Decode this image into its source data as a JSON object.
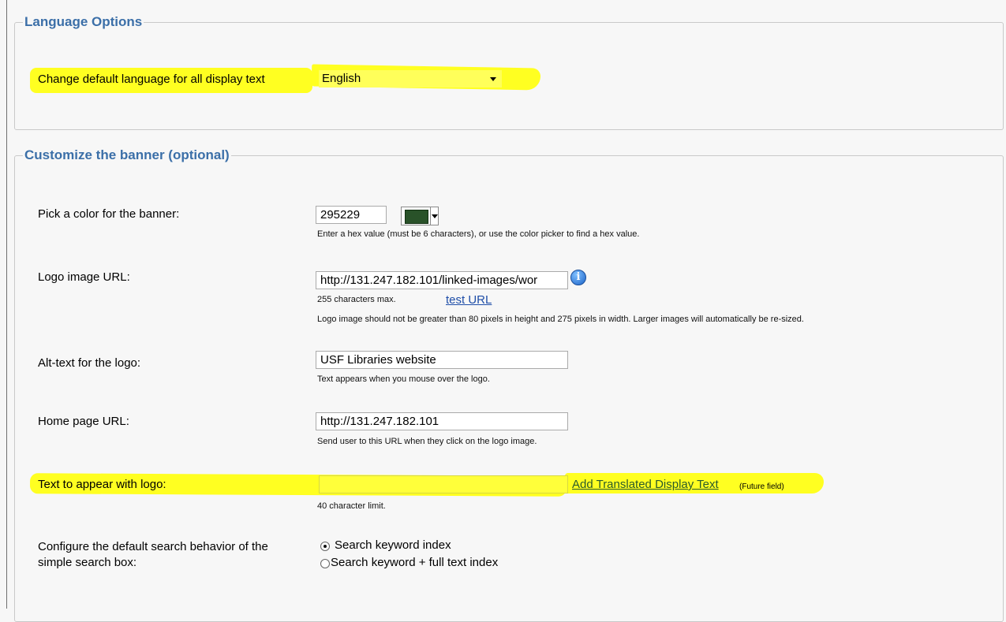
{
  "language": {
    "title": "Language Options",
    "label": "Change default language for all display text",
    "selected": "English"
  },
  "banner": {
    "title": "Customize the banner (optional)",
    "color": {
      "label": "Pick a color for the banner:",
      "value": "295229",
      "swatch": "#295229",
      "hint": "Enter a hex value (must be 6 characters), or use the color picker to find a hex value."
    },
    "logo": {
      "label": "Logo image URL:",
      "value": "http://131.247.182.101/linked-images/wor",
      "max": "255 characters max.",
      "test_link": "test URL",
      "hint": "Logo image should not be greater than 80 pixels in height and 275 pixels in width. Larger images will automatically be re-sized."
    },
    "alt": {
      "label": "Alt-text for the logo:",
      "value": "USF Libraries website",
      "hint": "Text appears when you mouse over the logo."
    },
    "home": {
      "label": "Home page URL:",
      "value": "http://131.247.182.101",
      "hint": "Send user to this URL when they click on the logo image."
    },
    "logo_text": {
      "label": "Text to appear with logo:",
      "value": "",
      "link": "Add Translated Display Text",
      "future": "(Future field)",
      "hint": "40 character limit."
    },
    "search": {
      "label_line1": "Configure the default search behavior of the",
      "label_line2": "simple search box:",
      "options": [
        "Search keyword index",
        "Search keyword + full text index"
      ],
      "selected_index": 0
    }
  },
  "colors": {
    "highlight": "#ffff21",
    "title": "#3b6fa8",
    "link": "#1f4ea8"
  }
}
